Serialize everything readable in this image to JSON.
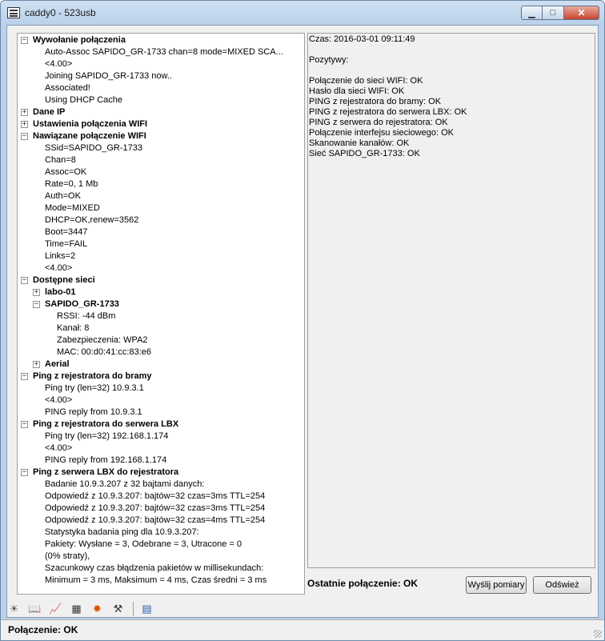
{
  "window": {
    "title": "caddy0 - 523usb",
    "minimize": "▁",
    "maximize": "□",
    "close": "✕"
  },
  "tree": {
    "rows": [
      {
        "text": "Wywołanie połączenia",
        "level": 0,
        "bold": true,
        "expander": "minus"
      },
      {
        "text": "Auto-Assoc SAPIDO_GR-1733 chan=8 mode=MIXED SCA...",
        "level": 1
      },
      {
        "text": "<4.00>",
        "level": 1
      },
      {
        "text": "Joining SAPIDO_GR-1733 now..",
        "level": 1
      },
      {
        "text": "Associated!",
        "level": 1
      },
      {
        "text": "Using DHCP Cache",
        "level": 1
      },
      {
        "text": "Dane IP",
        "level": 0,
        "bold": true,
        "expander": "plus"
      },
      {
        "text": "Ustawienia połączenia WIFI",
        "level": 0,
        "bold": true,
        "expander": "plus"
      },
      {
        "text": "Nawiązane połączenie WIFI",
        "level": 0,
        "bold": true,
        "expander": "minus"
      },
      {
        "text": "SSid=SAPIDO_GR-1733",
        "level": 1
      },
      {
        "text": "Chan=8",
        "level": 1
      },
      {
        "text": "Assoc=OK",
        "level": 1
      },
      {
        "text": "Rate=0, 1 Mb",
        "level": 1
      },
      {
        "text": "Auth=OK",
        "level": 1
      },
      {
        "text": "Mode=MIXED",
        "level": 1
      },
      {
        "text": "DHCP=OK,renew=3562",
        "level": 1
      },
      {
        "text": "Boot=3447",
        "level": 1
      },
      {
        "text": "Time=FAIL",
        "level": 1
      },
      {
        "text": "Links=2",
        "level": 1
      },
      {
        "text": "<4.00>",
        "level": 1
      },
      {
        "text": "Dostępne sieci",
        "level": 0,
        "bold": true,
        "expander": "minus"
      },
      {
        "text": "labo-01",
        "level": 1,
        "bold": true,
        "expander": "plus"
      },
      {
        "text": "SAPIDO_GR-1733",
        "level": 1,
        "bold": true,
        "expander": "minus"
      },
      {
        "text": "RSSI: -44 dBm",
        "level": 2
      },
      {
        "text": "Kanał: 8",
        "level": 2
      },
      {
        "text": "Zabezpieczenia: WPA2",
        "level": 2
      },
      {
        "text": "MAC: 00:d0:41:cc:83:e6",
        "level": 2
      },
      {
        "text": "Aerial",
        "level": 1,
        "bold": true,
        "expander": "plus"
      },
      {
        "text": "Ping z rejestratora do bramy",
        "level": 0,
        "bold": true,
        "expander": "minus"
      },
      {
        "text": "Ping try (len=32) 10.9.3.1",
        "level": 1
      },
      {
        "text": "<4.00>",
        "level": 1
      },
      {
        "text": "PING reply from 10.9.3.1",
        "level": 1
      },
      {
        "text": "Ping z rejestratora do serwera LBX",
        "level": 0,
        "bold": true,
        "expander": "minus"
      },
      {
        "text": "Ping try (len=32) 192.168.1.174",
        "level": 1
      },
      {
        "text": "<4.00>",
        "level": 1
      },
      {
        "text": "PING reply from 192.168.1.174",
        "level": 1
      },
      {
        "text": "Ping z serwera LBX do rejestratora",
        "level": 0,
        "bold": true,
        "expander": "minus"
      },
      {
        "text": "Badanie 10.9.3.207 z 32 bajtami danych:",
        "level": 1
      },
      {
        "text": "Odpowiedź z 10.9.3.207: bajtów=32 czas=3ms TTL=254",
        "level": 1
      },
      {
        "text": "Odpowiedź z 10.9.3.207: bajtów=32 czas=3ms TTL=254",
        "level": 1
      },
      {
        "text": "Odpowiedź z 10.9.3.207: bajtów=32 czas=4ms TTL=254",
        "level": 1
      },
      {
        "text": "Statystyka badania ping dla 10.9.3.207:",
        "level": 1
      },
      {
        "text": "Pakiety: Wysłane = 3, Odebrane = 3, Utracone = 0",
        "level": 1
      },
      {
        "text": "(0% straty),",
        "level": 1
      },
      {
        "text": "Szacunkowy czas błądzenia pakietów w millisekundach:",
        "level": 1
      },
      {
        "text": "Minimum = 3 ms, Maksimum = 4 ms, Czas średni = 3 ms",
        "level": 1
      }
    ]
  },
  "details": {
    "lines": [
      "Czas: 2016-03-01 09:11:49",
      "",
      "Pozytywy:",
      "",
      "Połączenie do sieci WIFI: OK",
      "Hasło dla sieci WIFI: OK",
      "PING z rejestratora do bramy: OK",
      "PING z rejestratora do serwera LBX: OK",
      "PING z serwera do rejestratora: OK",
      "Połączenie interfejsu sieciowego: OK",
      "Skanowanie kanałów: OK",
      "Sieć SAPIDO_GR-1733: OK"
    ]
  },
  "footer": {
    "last_connection": "Ostatnie połączenie: OK",
    "send_button": "Wyślij pomiary",
    "refresh_button": "Odśwież"
  },
  "toolbar": {
    "icons": [
      {
        "name": "settings-sun-icon",
        "glyph": "☀",
        "color": "#555555"
      },
      {
        "name": "book-icon",
        "glyph": "📖",
        "color": "#333333"
      },
      {
        "name": "chart-icon",
        "glyph": "📈",
        "color": "#cc0000"
      },
      {
        "name": "table-icon",
        "glyph": "▦",
        "color": "#333333"
      },
      {
        "name": "bug-icon",
        "glyph": "✹",
        "color": "#e05000"
      },
      {
        "name": "tools-icon",
        "glyph": "⚒",
        "color": "#333333"
      },
      {
        "name": "monitor-icon",
        "glyph": "▤",
        "color": "#1f5fa8"
      }
    ]
  },
  "status": {
    "text": "Połączenie: OK"
  }
}
